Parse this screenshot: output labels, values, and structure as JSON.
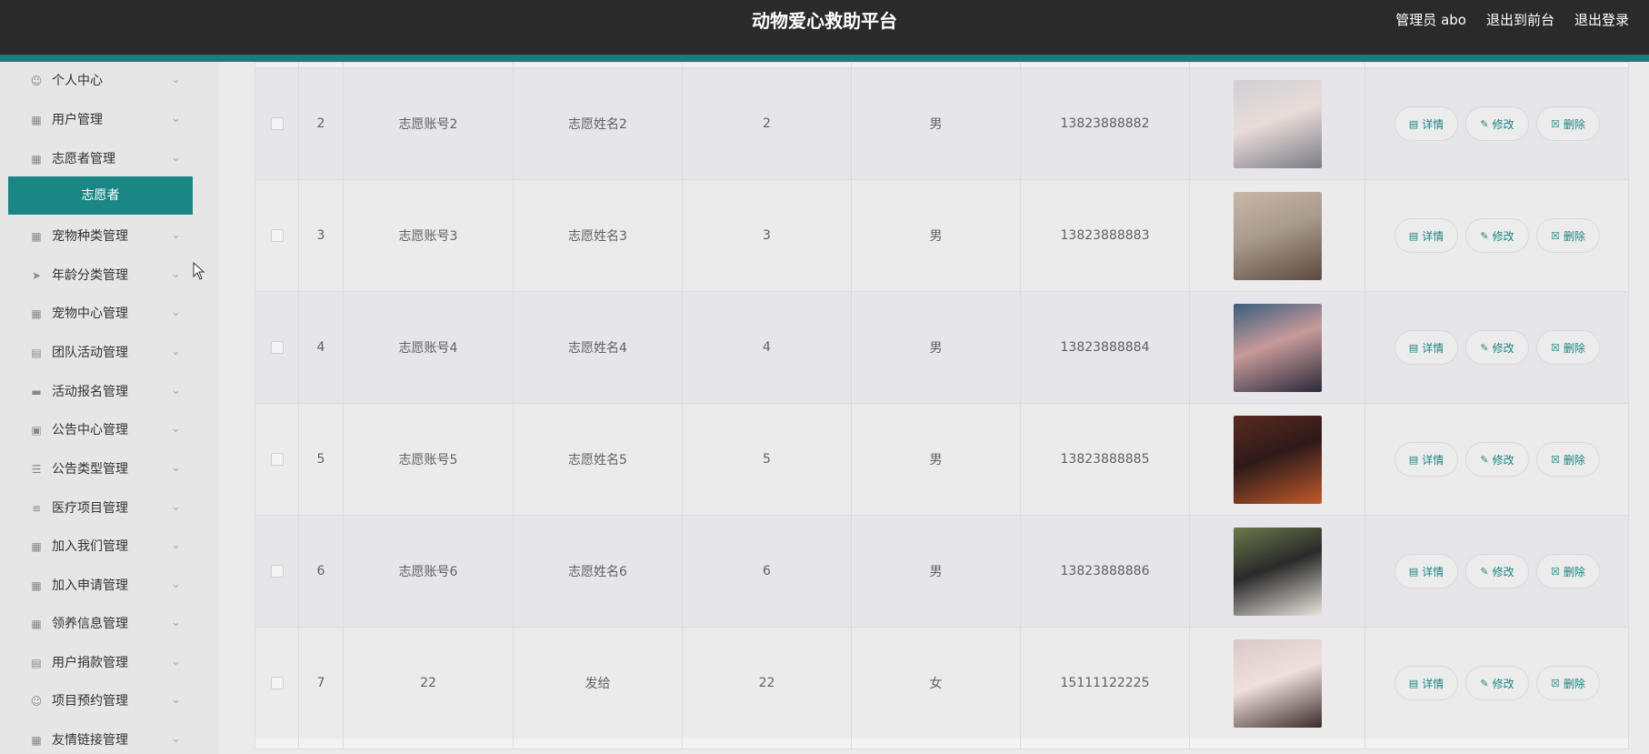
{
  "header": {
    "title": "动物爱心救助平台",
    "admin_label": "管理员 abo",
    "front_link": "退出到前台",
    "logout_link": "退出登录"
  },
  "colors": {
    "accent": "#1a8784",
    "header_bg": "#2a2a2a"
  },
  "sidebar": {
    "items": [
      {
        "label": "个人中心",
        "icon": "user-icon"
      },
      {
        "label": "用户管理",
        "icon": "grid-icon"
      },
      {
        "label": "志愿者管理",
        "icon": "grid-icon"
      },
      {
        "label": "宠物种类管理",
        "icon": "grid-icon"
      },
      {
        "label": "年龄分类管理",
        "icon": "send-icon"
      },
      {
        "label": "宠物中心管理",
        "icon": "grid-icon"
      },
      {
        "label": "团队活动管理",
        "icon": "clipboard-icon"
      },
      {
        "label": "活动报名管理",
        "icon": "monitor-icon"
      },
      {
        "label": "公告中心管理",
        "icon": "printer-icon"
      },
      {
        "label": "公告类型管理",
        "icon": "list-icon"
      },
      {
        "label": "医疗项目管理",
        "icon": "sliders-icon"
      },
      {
        "label": "加入我们管理",
        "icon": "grid-icon"
      },
      {
        "label": "加入申请管理",
        "icon": "grid-icon"
      },
      {
        "label": "领养信息管理",
        "icon": "grid-icon"
      },
      {
        "label": "用户捐款管理",
        "icon": "clipboard-icon"
      },
      {
        "label": "项目预约管理",
        "icon": "user-icon"
      },
      {
        "label": "友情链接管理",
        "icon": "grid-icon"
      }
    ],
    "active_submenu": "志愿者"
  },
  "table": {
    "actions": {
      "detail": "详情",
      "edit": "修改",
      "delete": "删除"
    },
    "rows": [
      {
        "index": "2",
        "account": "志愿账号2",
        "name": "志愿姓名2",
        "age": "2",
        "gender": "男",
        "phone": "13823888882",
        "photo": "avatar-photo"
      },
      {
        "index": "3",
        "account": "志愿账号3",
        "name": "志愿姓名3",
        "age": "3",
        "gender": "男",
        "phone": "13823888883",
        "photo": "avatar-photo"
      },
      {
        "index": "4",
        "account": "志愿账号4",
        "name": "志愿姓名4",
        "age": "4",
        "gender": "男",
        "phone": "13823888884",
        "photo": "avatar-photo"
      },
      {
        "index": "5",
        "account": "志愿账号5",
        "name": "志愿姓名5",
        "age": "5",
        "gender": "男",
        "phone": "13823888885",
        "photo": "avatar-photo"
      },
      {
        "index": "6",
        "account": "志愿账号6",
        "name": "志愿姓名6",
        "age": "6",
        "gender": "男",
        "phone": "13823888886",
        "photo": "avatar-photo"
      },
      {
        "index": "7",
        "account": "22",
        "name": "发给",
        "age": "22",
        "gender": "女",
        "phone": "15111122225",
        "photo": "avatar-photo"
      }
    ]
  }
}
